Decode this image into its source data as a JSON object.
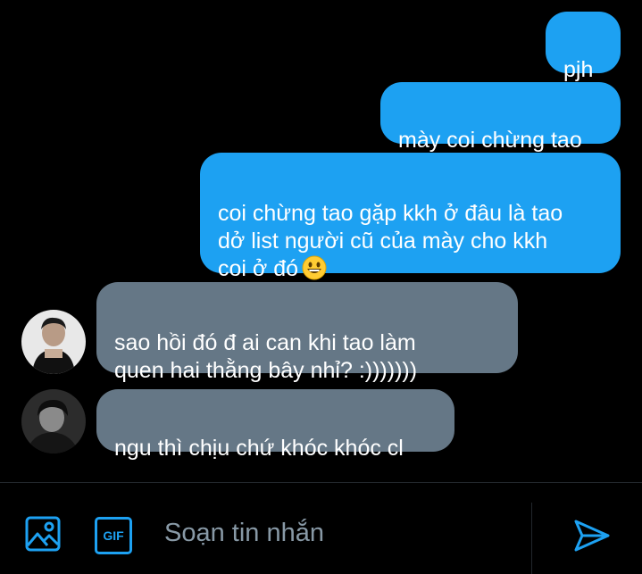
{
  "messages": [
    {
      "direction": "outgoing",
      "text": "pjh"
    },
    {
      "direction": "outgoing",
      "text": "mày coi chừng tao"
    },
    {
      "direction": "outgoing",
      "text": "coi chừng tao gặp kkh ở đâu là tao\ndở list người cũ của mày cho kkh\ncoi ở đó",
      "emoji": "grinning-face"
    },
    {
      "direction": "incoming",
      "text": "sao hồi đó đ ai can khi tao làm\nquen hai thằng bây nhỉ? :)))))))",
      "avatar": "avatar-user-1"
    },
    {
      "direction": "incoming",
      "text": "ngu thì chịu chứ khóc khóc cl",
      "avatar": "avatar-user-2"
    }
  ],
  "composer": {
    "placeholder": "Soạn tin nhắn",
    "image_icon": "image-icon",
    "gif_icon": "gif-icon",
    "gif_label": "GIF",
    "send_icon": "send-icon"
  },
  "colors": {
    "background": "#000000",
    "outgoing_bubble": "#1da1f2",
    "incoming_bubble": "#657786",
    "accent": "#1da1f2",
    "placeholder": "#8899a6"
  }
}
